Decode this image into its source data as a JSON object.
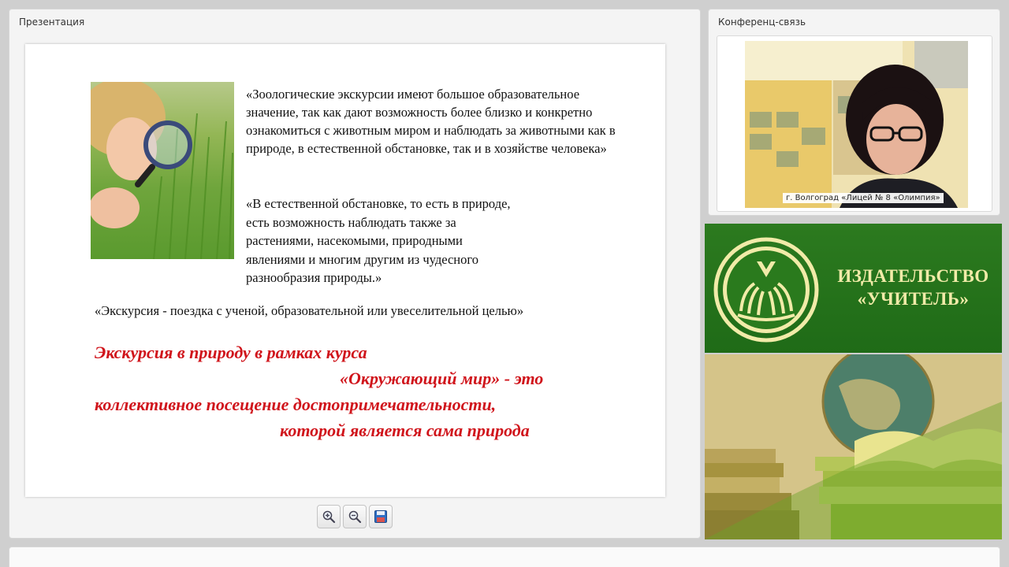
{
  "presentation": {
    "panel_title": "Презентация",
    "slide": {
      "paragraph1": "«Зоологические экскурсии имеют большое образовательное значение, так как дают возможность более близко и конкретно ознакомиться с животным миром и наблюдать за животными как в природе, в естественной обстановке, так и в хозяйстве человека»",
      "paragraph2_lines": [
        "«В естественной обстановке, то есть в природе,",
        " есть возможность наблюдать также за",
        "растениями, насекомыми, природными",
        "явлениями и многим другим из чудесного",
        " разнообразия природы.»"
      ],
      "paragraph3": "«Экскурсия - поездка с ученой, образовательной или увеселительной целью»",
      "red_lines": [
        "Экскурсия в природу в рамках курса",
        "«Окружающий мир» - это",
        "коллективное посещение достопримечательности,",
        "которой является сама природа"
      ]
    },
    "toolbar": {
      "zoom_in_icon": "zoom-in-icon",
      "zoom_out_icon": "zoom-out-icon",
      "save_icon": "save-icon"
    }
  },
  "conference": {
    "panel_title": "Конференц-связь",
    "video_caption": "г. Волгоград «Лицей № 8 «Олимпия»"
  },
  "publisher": {
    "name_line1": "ИЗДАТЕЛЬСТВО",
    "name_line2": "«УЧИТЕЛЬ»"
  },
  "colors": {
    "accent_red": "#d0141b",
    "publisher_green": "#1f6b17",
    "publisher_text": "#f1eba8"
  }
}
